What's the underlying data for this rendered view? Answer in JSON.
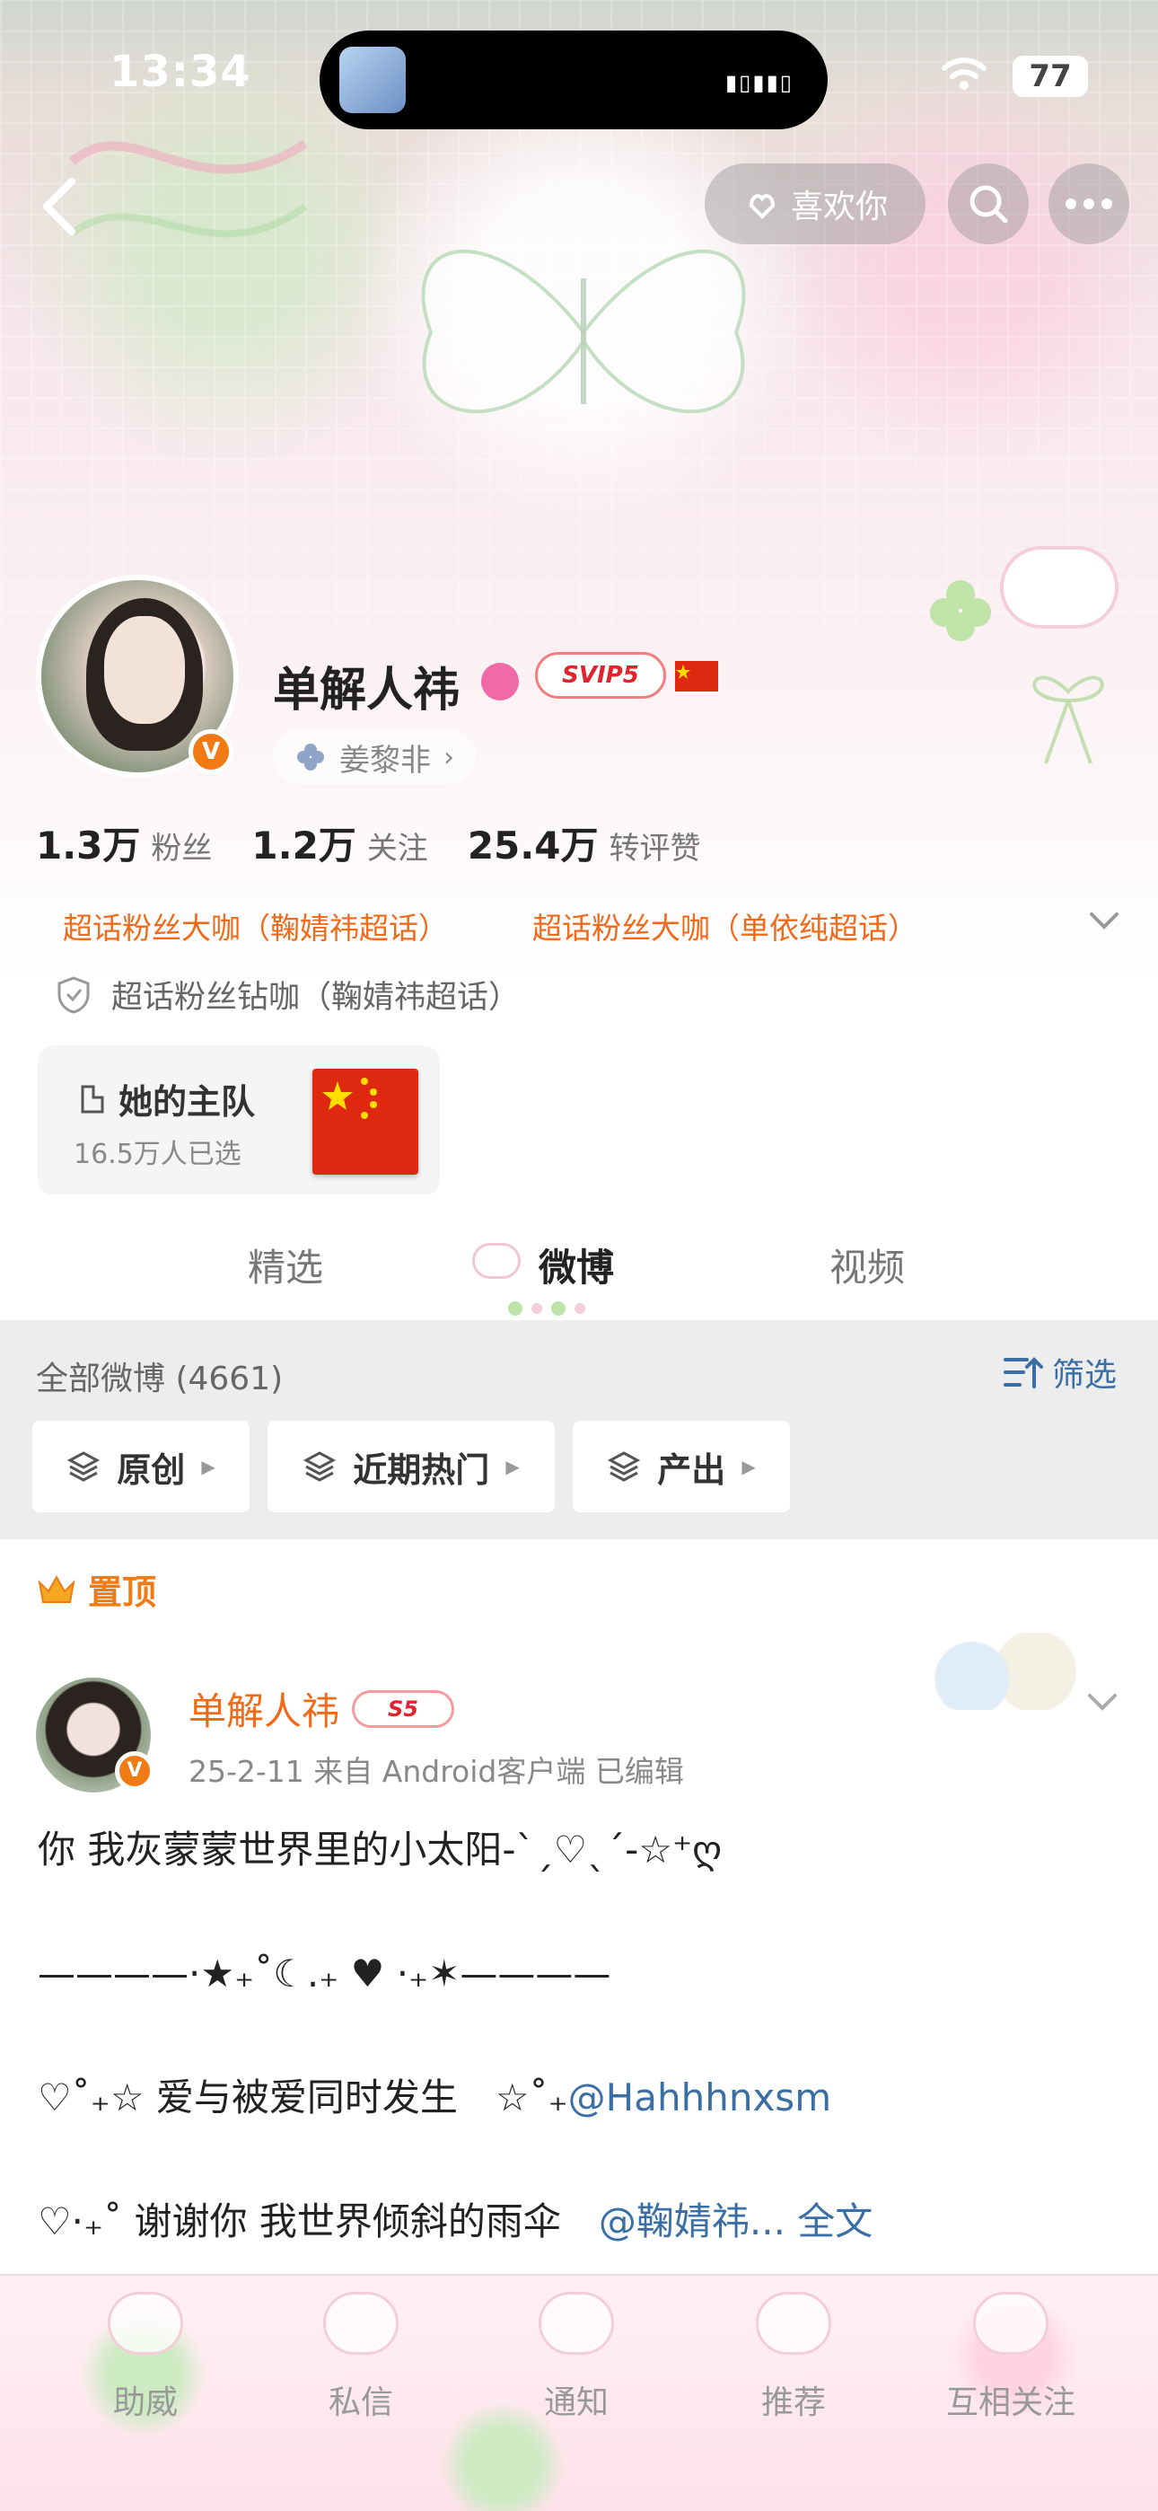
{
  "status_bar": {
    "time": "13:34",
    "battery": "77"
  },
  "header": {
    "like_label": "喜欢你"
  },
  "profile": {
    "name": "单解人祎",
    "vip_badge": "SVIP5",
    "linked_account": "姜黎非",
    "stats": [
      {
        "value": "1.3万",
        "label": "粉丝"
      },
      {
        "value": "1.2万",
        "label": "关注"
      },
      {
        "value": "25.4万",
        "label": "转评赞"
      }
    ],
    "tags": [
      "超话粉丝大咖（鞠婧祎超话）",
      "超话粉丝大咖（单依纯超话）"
    ],
    "fan_level": "超话粉丝钻咖（鞠婧祎超话）",
    "team": {
      "title": "她的主队",
      "subtitle": "16.5万人已选"
    }
  },
  "tabs": [
    {
      "label": "精选",
      "active": false
    },
    {
      "label": "微博",
      "active": true
    },
    {
      "label": "视频",
      "active": false
    }
  ],
  "feed": {
    "all_count_label": "全部微博 (4661)",
    "filter_label": "筛选",
    "chips": [
      "原创",
      "近期热门",
      "产出"
    ],
    "pinned_label": "置顶"
  },
  "post": {
    "author": "单解人祎",
    "level_badge": "S5",
    "meta": "25-2-11  来自 Android客户端  已编辑",
    "lines": {
      "l1": "你 我灰蒙蒙世界里的小太阳-ˋˏ♡ˎˊ-☆⁺ღ",
      "l2": "————·★₊˚☾.₊ ♥ ·₊✶————",
      "l3_text": "♡˚₊☆ 爱与被爱同时发生　☆˚₊",
      "l3_link": "@Hahhhnxsm",
      "l4_text": "♡·₊˚  谢谢你 我世界倾斜的雨伞　",
      "l4_link": "@鞠婧祎...",
      "l4_more": "全文"
    }
  },
  "bottom_nav": [
    "助威",
    "私信",
    "通知",
    "推荐",
    "互相关注"
  ],
  "colors": {
    "accent": "#f06a1a",
    "link": "#3a6fa6",
    "pinned": "#f07a14"
  }
}
